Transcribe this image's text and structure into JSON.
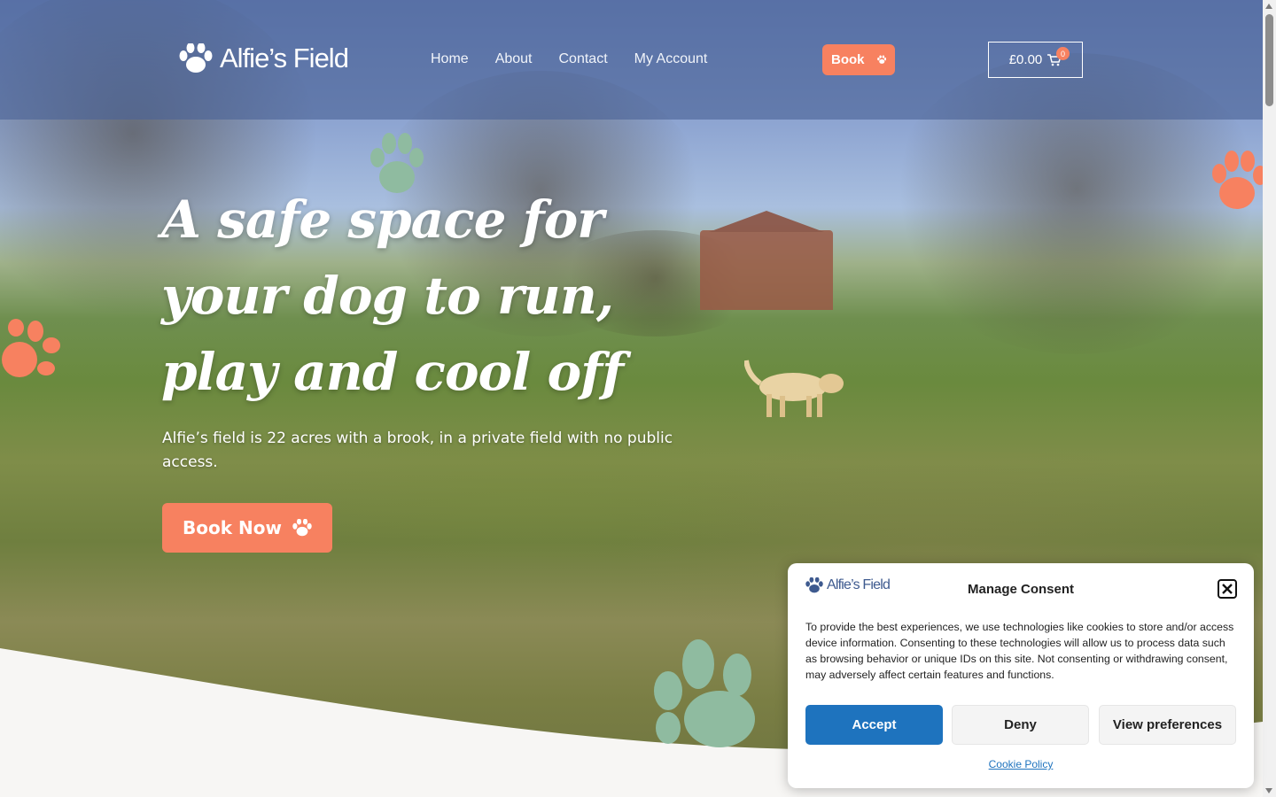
{
  "brand": {
    "name": "Alfie’s Field",
    "accent": "#f78160",
    "sage": "#8fbba0"
  },
  "nav": {
    "items": [
      "Home",
      "About",
      "Contact",
      "My Account"
    ],
    "book_label": "Book",
    "cart_total": "£0.00",
    "cart_count": "0"
  },
  "hero": {
    "headline_lines": [
      "A safe space for",
      "your dog to run,",
      "play and cool off"
    ],
    "subtext": "Alfie’s field is 22 acres with a brook, in a private field with no public access.",
    "cta_label": "Book Now"
  },
  "consent": {
    "logo_text": "Alfie’s Field",
    "title": "Manage Consent",
    "body": "To provide the best experiences, we use technologies like cookies to store and/or access device information. Consenting to these technologies will allow us to process data such as browsing behavior or unique IDs on this site. Not consenting or withdrawing consent, may adversely affect certain features and functions.",
    "accept_label": "Accept",
    "deny_label": "Deny",
    "preferences_label": "View preferences",
    "policy_link": "Cookie Policy",
    "accept_color": "#1e73be"
  },
  "icons": [
    "paw-icon",
    "cart-icon",
    "close-icon"
  ]
}
